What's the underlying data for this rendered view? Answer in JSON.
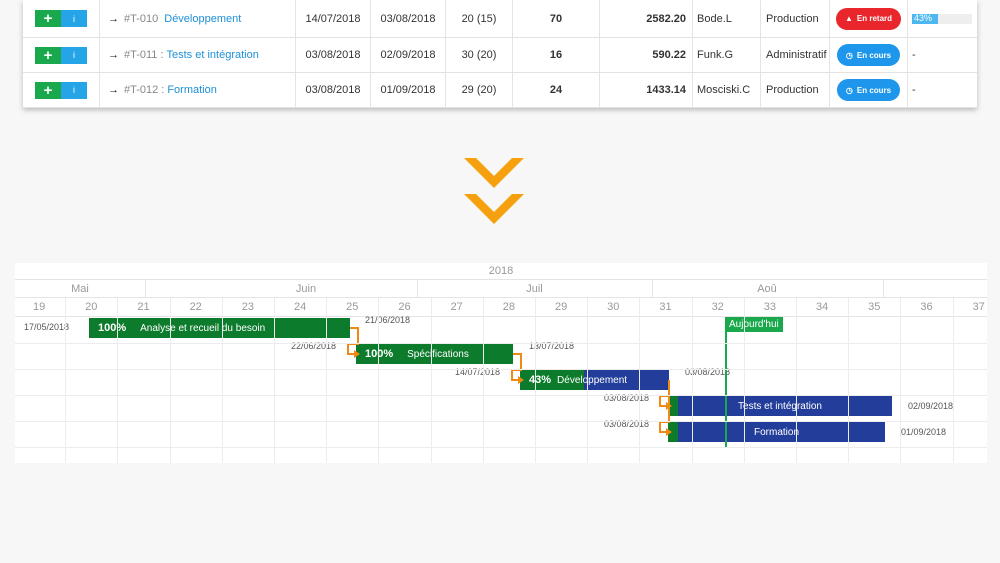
{
  "table": {
    "rows": [
      {
        "code": "#T-010",
        "sep": "",
        "name": "Développement",
        "start": "14/07/2018",
        "end": "03/08/2018",
        "duration": "20 (15)",
        "hours": "70",
        "cost": "2582.20",
        "resource": "Bode.L",
        "type": "Production",
        "status": "En retard",
        "status_kind": "late",
        "status_icon": "warning-icon",
        "progress": "43%",
        "progress_value": 43
      },
      {
        "code": "#T-011",
        "sep": ":",
        "name": "Tests et intégration",
        "start": "03/08/2018",
        "end": "02/09/2018",
        "duration": "30 (20)",
        "hours": "16",
        "cost": "590.22",
        "resource": "Funk.G",
        "type": "Administratif",
        "status": "En cours",
        "status_kind": "cours",
        "status_icon": "clock-icon",
        "progress": "-",
        "progress_value": null
      },
      {
        "code": "#T-012",
        "sep": ":",
        "name": "Formation",
        "start": "03/08/2018",
        "end": "01/09/2018",
        "duration": "29 (20)",
        "hours": "24",
        "cost": "1433.14",
        "resource": "Mosciski.C",
        "type": "Production",
        "status": "En cours",
        "status_kind": "cours",
        "status_icon": "clock-icon",
        "progress": "-",
        "progress_value": null
      }
    ],
    "add_icon": "+",
    "info_icon": "i",
    "arrow_icon": "→"
  },
  "colors": {
    "green": "#19a84c",
    "blue": "#26a4e8",
    "late": "#e8262b",
    "chevron": "#f5a00e",
    "bar_green": "#0d7b2c",
    "bar_blue": "#233e9a"
  },
  "gantt": {
    "year": "2018",
    "months": [
      "Mai",
      "Juin",
      "Juil",
      "Aoû"
    ],
    "weeks": [
      "19",
      "20",
      "21",
      "22",
      "23",
      "24",
      "25",
      "26",
      "27",
      "28",
      "29",
      "30",
      "31",
      "32",
      "33",
      "34",
      "35",
      "36",
      "37"
    ],
    "today_label": "Aujourd'hui",
    "tasks": [
      {
        "name": "Analyse et recueil du besoin",
        "progress": "100%",
        "start": "17/05/2018",
        "end": "21/06/2018"
      },
      {
        "name": "Spécifications",
        "progress": "100%",
        "start": "22/06/2018",
        "end": "13/07/2018"
      },
      {
        "name": "Développement",
        "progress": "43%",
        "start": "14/07/2018",
        "end": "03/08/2018"
      },
      {
        "name": "Tests et intégration",
        "progress": "",
        "start": "03/08/2018",
        "end": "02/09/2018"
      },
      {
        "name": "Formation",
        "progress": "",
        "start": "03/08/2018",
        "end": "01/09/2018"
      }
    ]
  }
}
